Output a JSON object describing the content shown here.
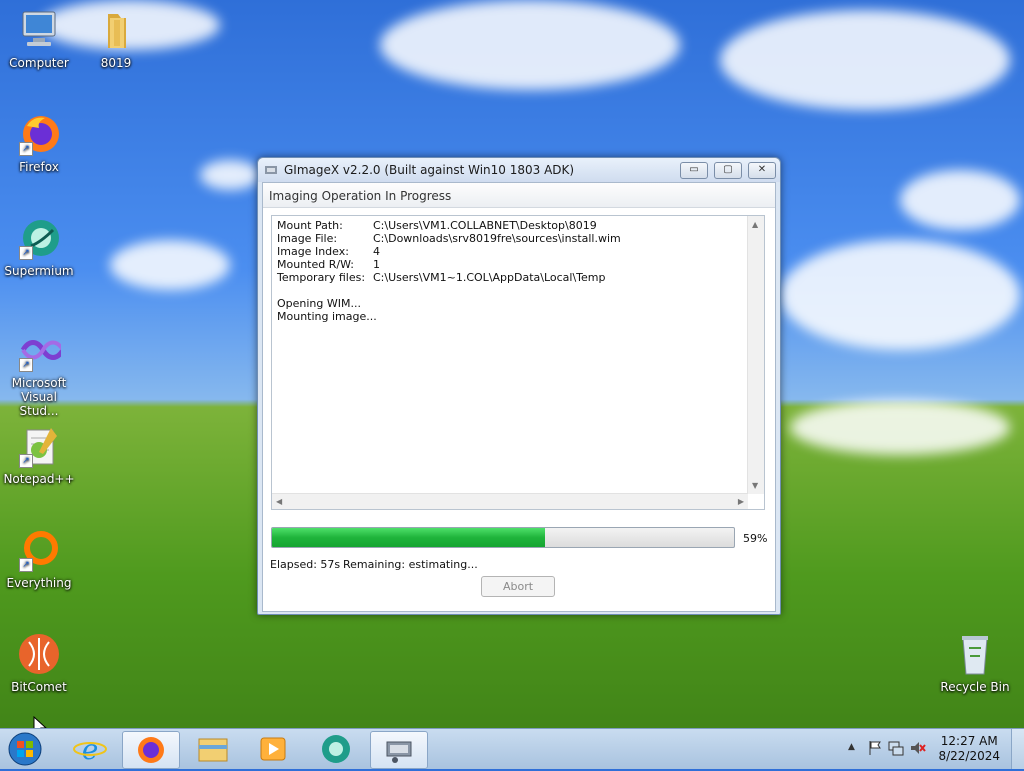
{
  "desktop": {
    "icons": [
      {
        "label": "Computer",
        "name": "computer"
      },
      {
        "label": "8019",
        "name": "folder-8019"
      },
      {
        "label": "Firefox",
        "name": "firefox"
      },
      {
        "label": "Supermium",
        "name": "supermium"
      },
      {
        "label": "Microsoft Visual Stud...",
        "line1": "Microsoft",
        "line2": "Visual Stud...",
        "name": "visual-studio"
      },
      {
        "label": "Notepad++",
        "name": "notepad-plus-plus"
      },
      {
        "label": "Everything",
        "name": "everything"
      },
      {
        "label": "BitComet",
        "name": "bitcomet"
      },
      {
        "label": "Recycle Bin",
        "name": "recycle-bin"
      }
    ]
  },
  "window": {
    "title": "GImageX v2.2.0 (Built against Win10 1803 ADK)",
    "buttons": {
      "minimize": "▭",
      "maximize": "▢",
      "close": "✕"
    },
    "group_title": "Imaging Operation In Progress",
    "log": {
      "fields": [
        {
          "key": "Mount Path:",
          "value": "C:\\Users\\VM1.COLLABNET\\Desktop\\8019"
        },
        {
          "key": "Image File:",
          "value": "C:\\Downloads\\srv8019fre\\sources\\install.wim"
        },
        {
          "key": "Image Index:",
          "value": "4"
        },
        {
          "key": "Mounted R/W:",
          "value": "1"
        },
        {
          "key": "Temporary files:",
          "value": "C:\\Users\\VM1~1.COL\\AppData\\Local\\Temp"
        }
      ],
      "lines": [
        "Opening WIM...",
        "Mounting image..."
      ]
    },
    "progress": {
      "percent_label": "59%",
      "value": 0.59
    },
    "elapsed": "Elapsed: 57s",
    "remaining": "Remaining: estimating...",
    "abort_label": "Abort"
  },
  "taskbar": {
    "items": [
      "internet-explorer",
      "firefox",
      "file-explorer",
      "media-player",
      "supermium",
      "gimagex"
    ],
    "clock": {
      "time": "12:27 AM",
      "date": "8/22/2024"
    }
  },
  "colors": {
    "progress_fill": "#1fb43b",
    "taskbar": "#bcd2ea"
  }
}
